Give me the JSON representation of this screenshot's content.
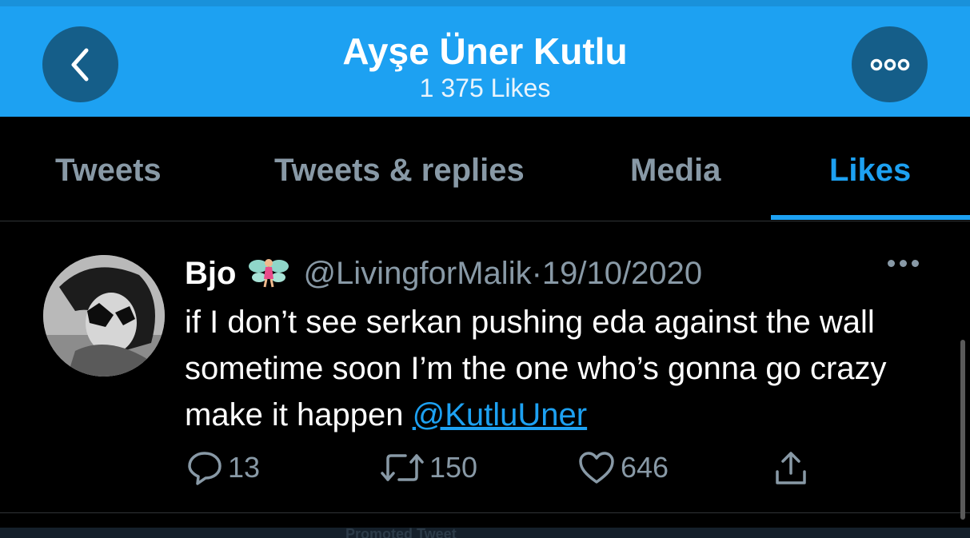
{
  "header": {
    "title": "Ayşe Üner Kutlu",
    "subtitle": "1 375 Likes",
    "back_icon": "chevron-left-icon",
    "more_icon": "more-options-icon",
    "color": "#1DA1F2"
  },
  "tabs": [
    {
      "label": "Tweets",
      "active": false
    },
    {
      "label": "Tweets & replies",
      "active": false
    },
    {
      "label": "Media",
      "active": false
    },
    {
      "label": "Likes",
      "active": true
    }
  ],
  "tweet": {
    "name": "Bjo",
    "name_emoji": "fairy-emoji",
    "handle": "@LivingforMalik",
    "separator": "·",
    "date": "19/10/2020",
    "text": "if I don’t see serkan pushing eda against the wall sometime soon I’m the one who’s gonna go crazy make it happen ",
    "mention": "@KutluUner",
    "replies": "13",
    "retweets": "150",
    "likes": "646"
  },
  "footer": {
    "promoted_label": "Promoted Tweet"
  }
}
